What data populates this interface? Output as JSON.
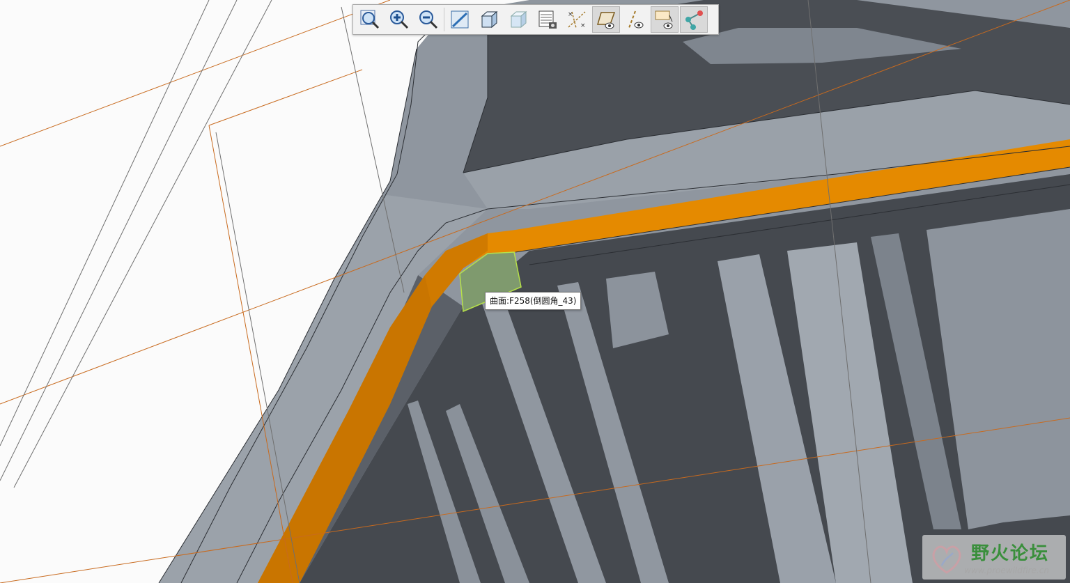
{
  "toolbar": {
    "items": [
      {
        "name": "zoom-fit",
        "icon": "magnifier-icon"
      },
      {
        "name": "zoom-in",
        "icon": "zoom-in-icon"
      },
      {
        "name": "zoom-out",
        "icon": "zoom-out-icon"
      },
      {
        "name": "repaint",
        "icon": "repaint-icon"
      },
      {
        "name": "display-style",
        "icon": "cube-shaded-icon"
      },
      {
        "name": "saved-orientations",
        "icon": "cube-views-icon"
      },
      {
        "name": "view-manager",
        "icon": "view-manager-icon"
      },
      {
        "name": "perspective",
        "icon": "datum-display-icon"
      },
      {
        "name": "datum-planes",
        "icon": "plane-display-icon"
      },
      {
        "name": "datum-axes",
        "icon": "axis-display-icon"
      },
      {
        "name": "annotations",
        "icon": "annotation-display-icon"
      },
      {
        "name": "datum-points",
        "icon": "point-display-icon"
      }
    ]
  },
  "tooltip": {
    "text": "曲面:F258(倒圆角_43)"
  },
  "watermark": {
    "title": "野火论坛",
    "url": "www.proewildfire.cn"
  },
  "colors": {
    "background": "#fbfbfb",
    "model_light": "#8f969f",
    "model_dark": "#474b51",
    "highlight_orange": "#e58a00",
    "selected_surface": "#7f9a6e",
    "datum_orange": "#c86a1e"
  }
}
